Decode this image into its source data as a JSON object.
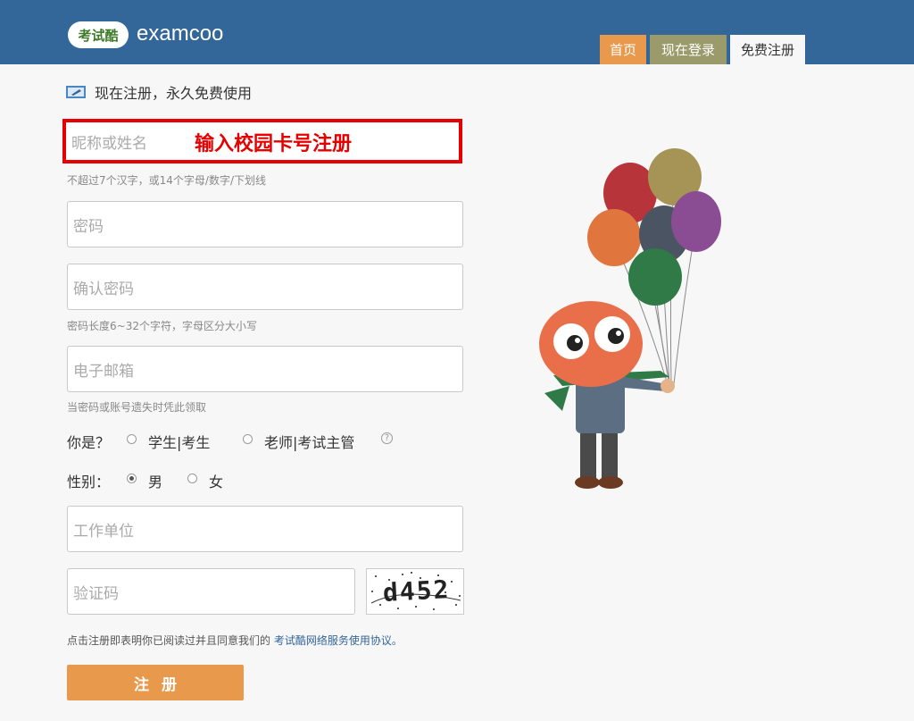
{
  "header": {
    "logo_badge": "考试酷",
    "logo_text": "examcoo",
    "tabs": [
      {
        "label": "首页",
        "color": "#e8994c"
      },
      {
        "label": "现在登录",
        "color": "#9b9a6a"
      },
      {
        "label": "免费注册",
        "active": true
      }
    ]
  },
  "form": {
    "headline": "现在注册，永久免费使用",
    "nickname": {
      "placeholder": "昵称或姓名",
      "hint": "不超过7个汉字，或14个字母/数字/下划线"
    },
    "annotation": "输入校园卡号注册",
    "password": {
      "placeholder": "密码"
    },
    "confirm": {
      "placeholder": "确认密码",
      "hint": "密码长度6~32个字符，字母区分大小写"
    },
    "email": {
      "placeholder": "电子邮箱",
      "hint": "当密码或账号遗失时凭此领取"
    },
    "role": {
      "label": "你是？",
      "options": [
        "学生|考生",
        "老师|考试主管"
      ],
      "help": "?"
    },
    "gender": {
      "label": "性别：",
      "options": [
        "男",
        "女"
      ],
      "selected": "男"
    },
    "org": {
      "placeholder": "工作单位"
    },
    "captcha": {
      "placeholder": "验证码",
      "image_text": "d452"
    },
    "agreement": {
      "text": "点击注册即表明你已阅读过并且同意我们的",
      "link": "考试酷网络服务使用协议。"
    },
    "submit": "注册"
  },
  "colors": {
    "header": "#336699",
    "accent": "#e8994c",
    "annotation": "#e60000"
  }
}
